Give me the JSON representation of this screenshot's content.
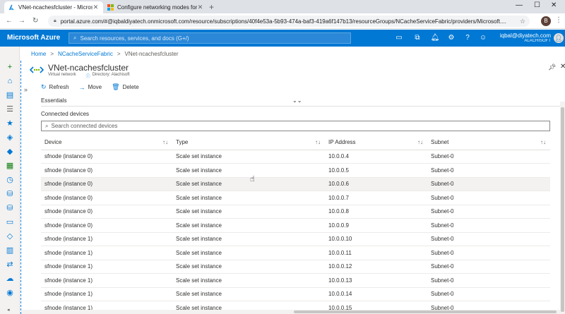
{
  "browser": {
    "tabs": [
      {
        "title": "VNet-ncachesfcluster - Microsoft",
        "active": true,
        "favicon": "azure-a-icon"
      },
      {
        "title": "Configure networking modes for",
        "active": false,
        "favicon": "windows-icon"
      }
    ],
    "new_tab": "+",
    "url": "portal.azure.com/#@iqbaldiyatech.onmicrosoft.com/resource/subscriptions/40f4e53a-5b93-474a-baf3-419a6f147b13/resourceGroups/NCacheServiceFabric/providers/Microsoft....",
    "profile_initial": "B"
  },
  "azure": {
    "brand": "Microsoft Azure",
    "search_placeholder": "Search resources, services, and docs (G+/)",
    "account_email": "iqbal@diyatech.com",
    "account_org": "ALACHISOFT",
    "accent": "#0078d4"
  },
  "breadcrumb": [
    "Home",
    "NCacheServiceFabric",
    "VNet-ncachesfcluster"
  ],
  "blade": {
    "title": "VNet-ncachesfcluster",
    "resource_type": "Virtual network",
    "directory": "Directory: Alachisoft",
    "toolbar": {
      "refresh": "Refresh",
      "move": "Move",
      "delete": "Delete"
    },
    "essentials": "Essentials",
    "section_title": "Connected devices",
    "search_placeholder": "Search connected devices"
  },
  "table": {
    "columns": [
      "Device",
      "Type",
      "IP Address",
      "Subnet"
    ],
    "rows": [
      [
        "sfnode (instance 0)",
        "Scale set instance",
        "10.0.0.4",
        "Subnet-0"
      ],
      [
        "sfnode (instance 0)",
        "Scale set instance",
        "10.0.0.5",
        "Subnet-0"
      ],
      [
        "sfnode (instance 0)",
        "Scale set instance",
        "10.0.0.6",
        "Subnet-0"
      ],
      [
        "sfnode (instance 0)",
        "Scale set instance",
        "10.0.0.7",
        "Subnet-0"
      ],
      [
        "sfnode (instance 0)",
        "Scale set instance",
        "10.0.0.8",
        "Subnet-0"
      ],
      [
        "sfnode (instance 0)",
        "Scale set instance",
        "10.0.0.9",
        "Subnet-0"
      ],
      [
        "sfnode (instance 1)",
        "Scale set instance",
        "10.0.0.10",
        "Subnet-0"
      ],
      [
        "sfnode (instance 1)",
        "Scale set instance",
        "10.0.0.11",
        "Subnet-0"
      ],
      [
        "sfnode (instance 1)",
        "Scale set instance",
        "10.0.0.12",
        "Subnet-0"
      ],
      [
        "sfnode (instance 1)",
        "Scale set instance",
        "10.0.0.13",
        "Subnet-0"
      ],
      [
        "sfnode (instance 1)",
        "Scale set instance",
        "10.0.0.14",
        "Subnet-0"
      ],
      [
        "sfnode (instance 1)",
        "Scale set instance",
        "10.0.0.15",
        "Subnet-0"
      ]
    ]
  }
}
